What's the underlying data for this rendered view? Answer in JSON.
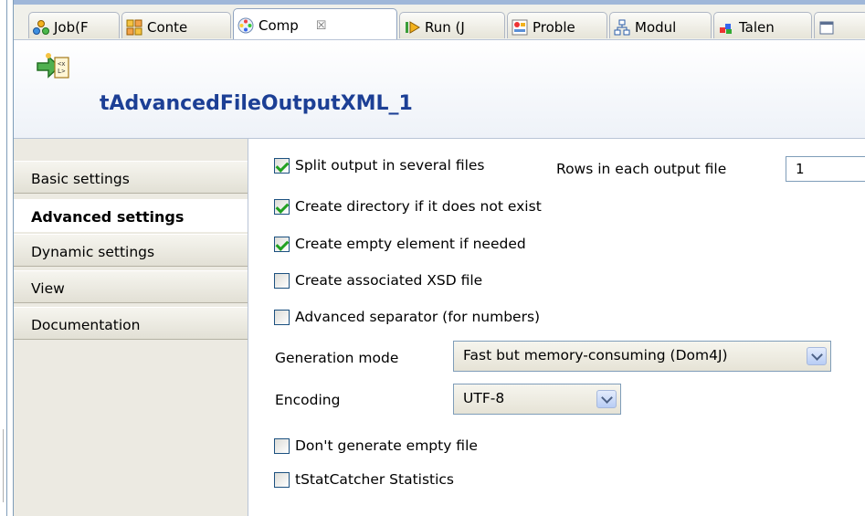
{
  "tabs": [
    {
      "label": "Job(F",
      "icon": "job-icon"
    },
    {
      "label": "Conte",
      "icon": "context-icon"
    },
    {
      "label": "Comp",
      "icon": "component-icon",
      "active": true,
      "close": "☒"
    },
    {
      "label": "Run (J",
      "icon": "run-icon"
    },
    {
      "label": "Proble",
      "icon": "problems-icon"
    },
    {
      "label": "Modul",
      "icon": "modules-icon"
    },
    {
      "label": "Talen",
      "icon": "talend-icon"
    }
  ],
  "component": {
    "title": "tAdvancedFileOutputXML_1",
    "icon": "xml-output-icon"
  },
  "sidebar": {
    "items": [
      {
        "label": "Basic settings"
      },
      {
        "label": "Advanced settings",
        "active": true
      },
      {
        "label": "Dynamic settings"
      },
      {
        "label": "View"
      },
      {
        "label": "Documentation"
      }
    ]
  },
  "settings": {
    "split_output": {
      "label": "Split output in several files",
      "checked": true
    },
    "rows_label": "Rows in each output file",
    "rows_value": "1",
    "create_directory": {
      "label": "Create directory if it does not exist",
      "checked": true
    },
    "create_empty_element": {
      "label": "Create empty element if needed",
      "checked": true
    },
    "create_xsd": {
      "label": "Create associated XSD file",
      "checked": false
    },
    "advanced_separator": {
      "label": "Advanced separator (for numbers)",
      "checked": false
    },
    "generation_mode_label": "Generation mode",
    "generation_mode_value": "Fast but memory-consuming (Dom4J)",
    "encoding_label": "Encoding",
    "encoding_value": "UTF-8",
    "dont_generate_empty": {
      "label": "Don't generate empty file",
      "checked": false
    },
    "tstatcatcher": {
      "label": "tStatCatcher Statistics",
      "checked": false
    }
  },
  "colors": {
    "title": "#1c3f95",
    "check": "#21a121",
    "frame": "#7f9db9"
  }
}
